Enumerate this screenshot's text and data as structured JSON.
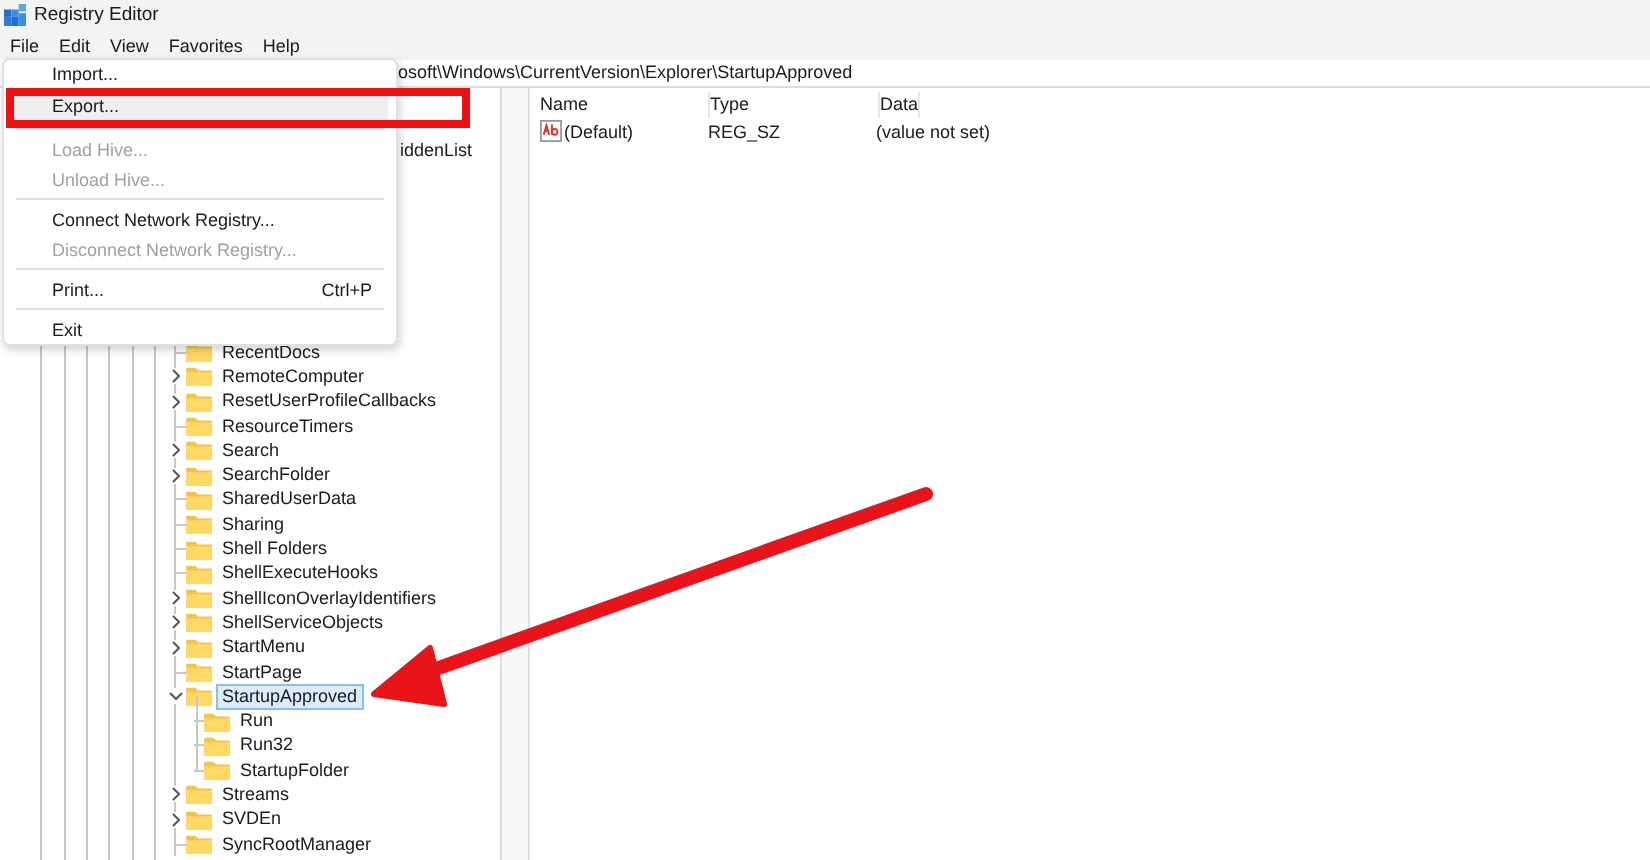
{
  "window": {
    "title": "Registry Editor"
  },
  "menu_bar": [
    {
      "label": "File"
    },
    {
      "label": "Edit"
    },
    {
      "label": "View"
    },
    {
      "label": "Favorites"
    },
    {
      "label": "Help"
    }
  ],
  "address": "osoft\\Windows\\CurrentVersion\\Explorer\\StartupApproved",
  "file_menu": [
    {
      "kind": "item",
      "label": "Import...",
      "disabled": false,
      "selected": false
    },
    {
      "kind": "item",
      "label": "Export...",
      "disabled": false,
      "selected": true
    },
    {
      "kind": "separator"
    },
    {
      "kind": "item",
      "label": "Load Hive...",
      "disabled": true,
      "selected": false
    },
    {
      "kind": "item",
      "label": "Unload Hive...",
      "disabled": true,
      "selected": false
    },
    {
      "kind": "separator"
    },
    {
      "kind": "item",
      "label": "Connect Network Registry...",
      "disabled": false,
      "selected": false
    },
    {
      "kind": "item",
      "label": "Disconnect Network Registry...",
      "disabled": true,
      "selected": false
    },
    {
      "kind": "separator"
    },
    {
      "kind": "item",
      "label": "Print...",
      "shortcut": "Ctrl+P",
      "disabled": false,
      "selected": false
    },
    {
      "kind": "separator"
    },
    {
      "kind": "item",
      "label": "Exit",
      "disabled": false,
      "selected": false
    }
  ],
  "tree": {
    "partial_item": "iddenList",
    "items": [
      {
        "label": "RecentDocs",
        "expandable": false,
        "selected": false
      },
      {
        "label": "RemoteComputer",
        "expandable": true,
        "expanded": false,
        "selected": false
      },
      {
        "label": "ResetUserProfileCallbacks",
        "expandable": true,
        "expanded": false,
        "selected": false
      },
      {
        "label": "ResourceTimers",
        "expandable": false,
        "selected": false
      },
      {
        "label": "Search",
        "expandable": true,
        "expanded": false,
        "selected": false
      },
      {
        "label": "SearchFolder",
        "expandable": true,
        "expanded": false,
        "selected": false
      },
      {
        "label": "SharedUserData",
        "expandable": false,
        "selected": false
      },
      {
        "label": "Sharing",
        "expandable": false,
        "selected": false
      },
      {
        "label": "Shell Folders",
        "expandable": false,
        "selected": false
      },
      {
        "label": "ShellExecuteHooks",
        "expandable": false,
        "selected": false
      },
      {
        "label": "ShellIconOverlayIdentifiers",
        "expandable": true,
        "expanded": false,
        "selected": false
      },
      {
        "label": "ShellServiceObjects",
        "expandable": true,
        "expanded": false,
        "selected": false
      },
      {
        "label": "StartMenu",
        "expandable": true,
        "expanded": false,
        "selected": false
      },
      {
        "label": "StartPage",
        "expandable": false,
        "selected": false
      },
      {
        "label": "StartupApproved",
        "expandable": true,
        "expanded": true,
        "selected": true,
        "children": [
          {
            "label": "Run",
            "expandable": false,
            "selected": false
          },
          {
            "label": "Run32",
            "expandable": false,
            "selected": false
          },
          {
            "label": "StartupFolder",
            "expandable": false,
            "selected": false
          }
        ]
      },
      {
        "label": "Streams",
        "expandable": true,
        "expanded": false,
        "selected": false
      },
      {
        "label": "SVDEn",
        "expandable": true,
        "expanded": false,
        "selected": false
      },
      {
        "label": "SyncRootManager",
        "expandable": false,
        "selected": false
      }
    ]
  },
  "values": {
    "columns": [
      "Name",
      "Type",
      "Data"
    ],
    "rows": [
      {
        "name": "(Default)",
        "type": "REG_SZ",
        "data": "(value not set)"
      }
    ]
  }
}
